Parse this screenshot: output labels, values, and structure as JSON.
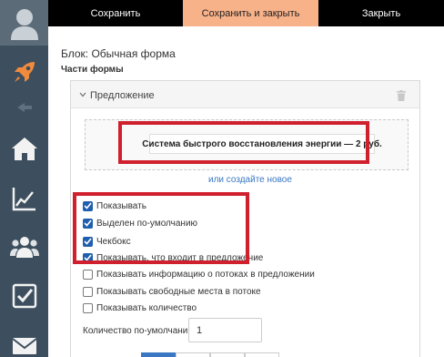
{
  "toolbar": {
    "save_label": "Сохранить",
    "save_close_label": "Сохранить и закрыть",
    "close_label": "Закрыть"
  },
  "block": {
    "title": "Блок: Обычная форма",
    "parts_label": "Части формы"
  },
  "panel": {
    "title": "Предложение",
    "offer_item": "Система быстрого восстановления энергии — 2 руб.",
    "create_new_link": "или создайте новое"
  },
  "options": [
    {
      "label": "Показывать",
      "checked": true
    },
    {
      "label": "Выделен по-умолчанию",
      "checked": true
    },
    {
      "label": "Чекбокс",
      "checked": true
    },
    {
      "label": "Показывать, что входит в предложение",
      "checked": true
    },
    {
      "label": "Показывать информацию о потоках в предложении",
      "checked": false
    },
    {
      "label": "Показывать свободные места в потоке",
      "checked": false
    },
    {
      "label": "Показывать количество",
      "checked": false
    }
  ],
  "quantity": {
    "label": "Количество по-умолчанию",
    "value": "1"
  },
  "sidebar": {
    "icons": [
      "user-avatar-icon",
      "rocket-icon",
      "collapse-icon",
      "home-icon",
      "chart-icon",
      "users-icon",
      "checkbox-icon",
      "mail-icon"
    ]
  },
  "colors": {
    "sidebar_bg": "#3d4f5f",
    "topbar_bg": "#000000",
    "save_close_bg": "#f8b28a",
    "highlight_red": "#d0202e",
    "link_blue": "#3a78c3",
    "checkbox_blue": "#1f5fae",
    "rocket_orange": "#f08a3c"
  }
}
